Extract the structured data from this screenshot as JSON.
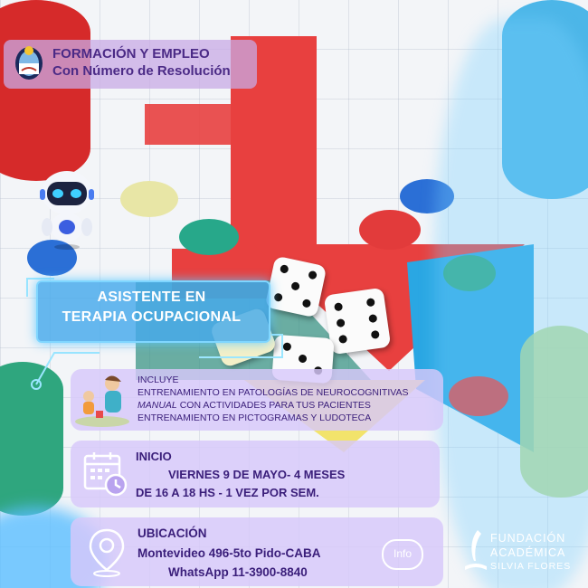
{
  "header": {
    "line1": "FORMACIÓN Y EMPLEO",
    "line2": "Con Número de Resolución"
  },
  "course_title": {
    "line1": "ASISTENTE EN",
    "line2": "TERAPIA OCUPACIONAL"
  },
  "includes": {
    "label": "INCLUYE",
    "items": [
      "ENTRENAMIENTO EN PATOLOGÍAS DE NEUROCOGNITIVAS",
      "CON ACTIVIDADES PARA TUS PACIENTES",
      "ENTRENAMIENTO EN PICTOGRAMAS Y LUDOTECA"
    ],
    "manual_word": "MANUAL"
  },
  "start": {
    "label": "INICIO",
    "date": "VIERNES 9  DE MAYO- 4 MESES",
    "schedule": "DE  16 A 18 HS  -  1 VEZ POR SEM."
  },
  "location": {
    "label": "UBICACIÓN",
    "address": "Montevideo 496-5to Pido-CABA",
    "whatsapp": "WhatsApp 11-3900-8840"
  },
  "info_label": "Info",
  "logo": {
    "line1": "FUNDACIÓN",
    "line2": "ACADÉMICA",
    "line3": "SILVIA FLORES"
  },
  "icons": {
    "seal": "argentina-seal-icon",
    "robot": "robot-icon",
    "calendar": "calendar-clock-icon",
    "pin": "location-pin-icon",
    "info": "info-bubble-icon",
    "logo": "quill-book-logo-icon"
  }
}
